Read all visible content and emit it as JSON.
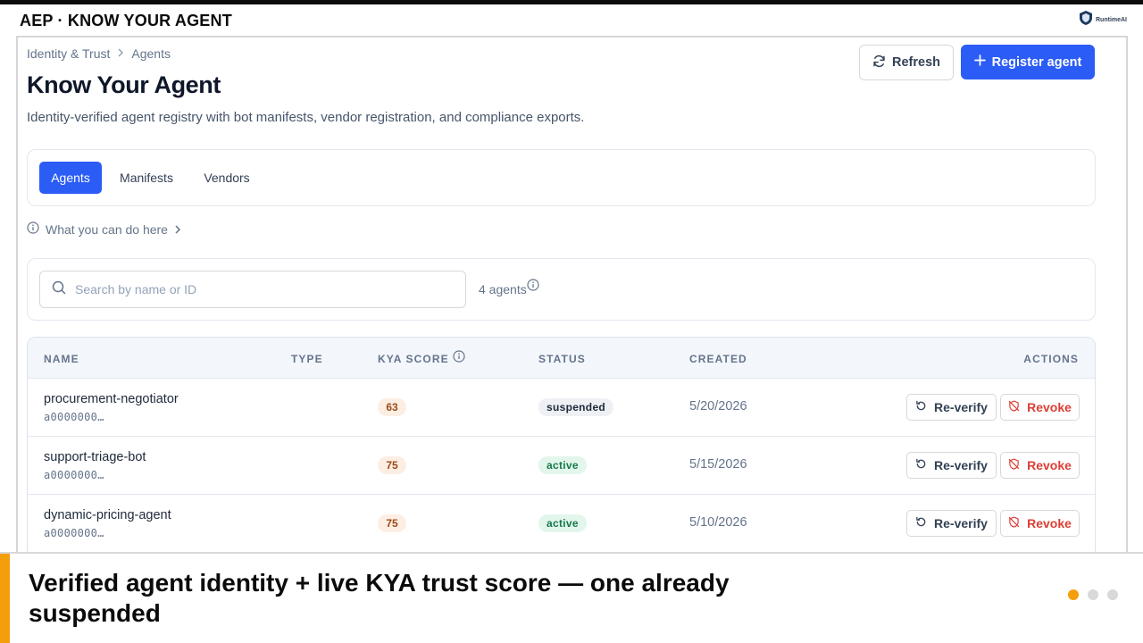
{
  "slide": {
    "title": "AEP · KNOW YOUR AGENT",
    "brand": "RuntimeAI",
    "caption": "Verified agent identity + live KYA trust score — one already suspended",
    "accent_color": "#f59e0b",
    "progress_dots": [
      true,
      false,
      false
    ]
  },
  "breadcrumb": [
    "Identity & Trust",
    "Agents"
  ],
  "page": {
    "title": "Know Your Agent",
    "subtitle": "Identity-verified agent registry with bot manifests, vendor registration, and compliance exports."
  },
  "actions": {
    "refresh_label": "Refresh",
    "register_label": "Register agent"
  },
  "tabs": [
    {
      "label": "Agents",
      "active": true
    },
    {
      "label": "Manifests",
      "active": false
    },
    {
      "label": "Vendors",
      "active": false
    }
  ],
  "help": {
    "label": "What you can do here"
  },
  "search": {
    "placeholder": "Search by name or ID",
    "value": "",
    "count_label": "4 agents"
  },
  "table": {
    "columns": [
      "NAME",
      "TYPE",
      "KYA SCORE",
      "STATUS",
      "CREATED",
      "ACTIONS"
    ],
    "rows": [
      {
        "name": "procurement-negotiator",
        "id": "a0000000…",
        "type": "",
        "kya_score": "63",
        "status": "suspended",
        "created": "5/20/2026"
      },
      {
        "name": "support-triage-bot",
        "id": "a0000000…",
        "type": "",
        "kya_score": "75",
        "status": "active",
        "created": "5/15/2026"
      },
      {
        "name": "dynamic-pricing-agent",
        "id": "a0000000…",
        "type": "",
        "kya_score": "75",
        "status": "active",
        "created": "5/10/2026"
      }
    ],
    "row_actions": {
      "reverify_label": "Re-verify",
      "revoke_label": "Revoke"
    }
  },
  "colors": {
    "primary": "#2b5cf6",
    "danger": "#dc3e35",
    "active_status": "#16794a",
    "score_badge": "#fdeee3"
  },
  "icons": {
    "brand": "shield-icon",
    "refresh": "refresh-icon",
    "register": "plus-icon",
    "help": "info-icon",
    "search": "search-icon",
    "count_info": "info-icon",
    "kya_info": "info-icon",
    "reverify": "rotate-ccw-icon",
    "revoke": "shield-off-icon"
  }
}
